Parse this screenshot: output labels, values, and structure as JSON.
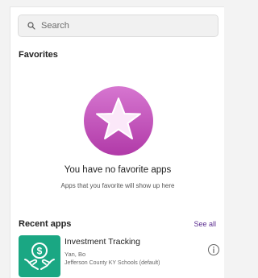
{
  "search": {
    "placeholder": "Search",
    "icon": "search-icon"
  },
  "favorites": {
    "title": "Favorites",
    "empty_title": "You have no favorite apps",
    "empty_subtitle": "Apps that you favorite will show up here",
    "empty_icon": "star-icon"
  },
  "recent": {
    "title": "Recent apps",
    "see_all_label": "See all",
    "apps": [
      {
        "name": "Investment Tracking",
        "owner": "Yan, Bo",
        "environment": "Jefferson County KY Schools (default)",
        "icon": "dollar-hands-icon",
        "tile_color": "#1aa783"
      }
    ]
  },
  "colors": {
    "accent": "#5b2d90",
    "star_gradient_top": "#d676d0",
    "star_gradient_bottom": "#b13aa8"
  }
}
